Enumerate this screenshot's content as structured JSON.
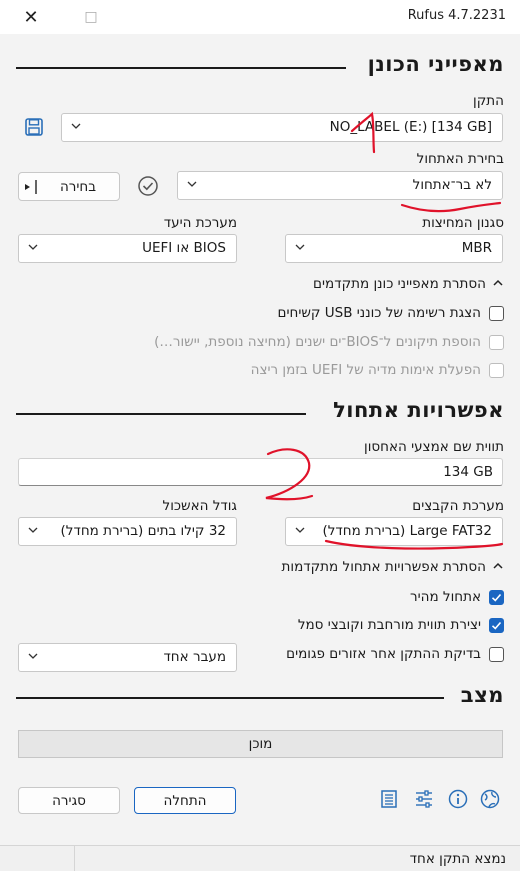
{
  "window": {
    "title": "Rufus 4.7.2231",
    "close_glyph": "✕",
    "maximize_glyph": "□"
  },
  "drive_section": {
    "title": "מאפייני הכונן",
    "device_label": "התקן",
    "device_value": "NO_LABEL (E:) [134 GB]",
    "boot_label": "בחירת האתחול",
    "boot_value": "לא בר־אתחול",
    "select_button": "בחירה",
    "partition_label": "סגנון המחיצות",
    "partition_value": "MBR",
    "target_label": "מערכת היעד",
    "target_value": "BIOS או UEFI",
    "advanced_toggle": "הסתרת מאפייני כונן מתקדמים",
    "options": [
      {
        "label": "הצגת רשימה של כונני USB קשיחים",
        "checked": false,
        "disabled": false
      },
      {
        "label": "הוספת תיקונים ל־BIOS־ים ישנים (מחיצה נוספת, יישור…)",
        "checked": false,
        "disabled": true
      },
      {
        "label": "הפעלת אימות מדיה של UEFI בזמן ריצה",
        "checked": false,
        "disabled": true
      }
    ]
  },
  "format_section": {
    "title": "אפשרויות אתחול",
    "volume_label_label": "תווית שם אמצעי האחסון",
    "volume_label_value": "134 GB",
    "filesystem_label": "מערכת הקבצים",
    "filesystem_value": "Large FAT32 (ברירת מחדל)",
    "cluster_label": "גודל האשכול",
    "cluster_value": "32 קילו בתים (ברירת מחדל)",
    "advanced_toggle": "הסתרת אפשרויות אתחול מתקדמות",
    "options": [
      {
        "label": "אתחול מהיר",
        "checked": true
      },
      {
        "label": "יצירת תווית מורחבת וקובצי סמל",
        "checked": true
      },
      {
        "label": "בדיקת ההתקן אחר אזורים פגומים",
        "checked": false
      }
    ],
    "passes_value": "מעבר אחד"
  },
  "status_section": {
    "title": "מצב",
    "status_text": "מוכן"
  },
  "actions": {
    "start_label": "התחלה",
    "close_label": "סגירה"
  },
  "statusbar": {
    "text": "נמצא התקן אחד"
  },
  "annotations": {
    "color": "#e0122a",
    "marks": [
      "1",
      "2"
    ]
  },
  "colors": {
    "accent": "#1a66c2",
    "icon_blue": "#2a6fb8"
  }
}
